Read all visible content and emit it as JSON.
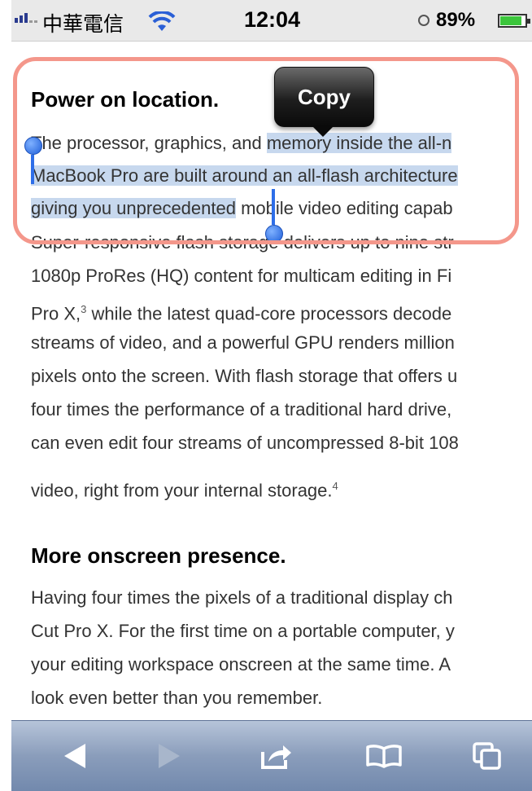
{
  "status_bar": {
    "carrier": "中華電信",
    "time": "12:04",
    "battery_percent": "89%",
    "battery_level": 0.89
  },
  "article": {
    "section1": {
      "heading": "Power on location.",
      "lines": [
        "The processor, graphics, and memory inside the all-n",
        "MacBook Pro are built around an all-flash architecture",
        "giving you unprecedented mobile video editing capab",
        "Super-responsive flash storage delivers up to nine str",
        "1080p ProRes (HQ) content for multicam editing in Fi",
        "Pro X,",
        "3",
        " while the latest quad-core processors decode",
        "streams of video, and a powerful GPU renders million",
        "pixels onto the screen. With flash storage that offers u",
        "four times the performance of a traditional hard drive,",
        "can even edit four streams of uncompressed 8-bit 108",
        "video, right from your internal storage.",
        "4"
      ]
    },
    "section2": {
      "heading": "More onscreen presence.",
      "lines": [
        "Having four times the pixels of a traditional display ch",
        "Cut Pro X. For the first time on a portable computer, y",
        "your editing workspace onscreen at the same time. A",
        "look even better than you remember."
      ]
    }
  },
  "selection": {
    "line1_pre": "The processor, graphics, and ",
    "line1_sel": "memory inside the all-n",
    "line2_sel": "MacBook Pro are built around an all-flash architecture",
    "line3_sel": "giving you unprecedented",
    "line3_post": " mobile video editing capab"
  },
  "context_menu": {
    "copy_label": "Copy"
  },
  "toolbar": {
    "icons": [
      "back-arrow-icon",
      "forward-arrow-icon",
      "share-icon",
      "bookmarks-icon",
      "tabs-icon"
    ]
  },
  "colors": {
    "selection": "#c7d8ee",
    "annotation": "#f4978b",
    "toolbar": "#8a9dbb"
  }
}
